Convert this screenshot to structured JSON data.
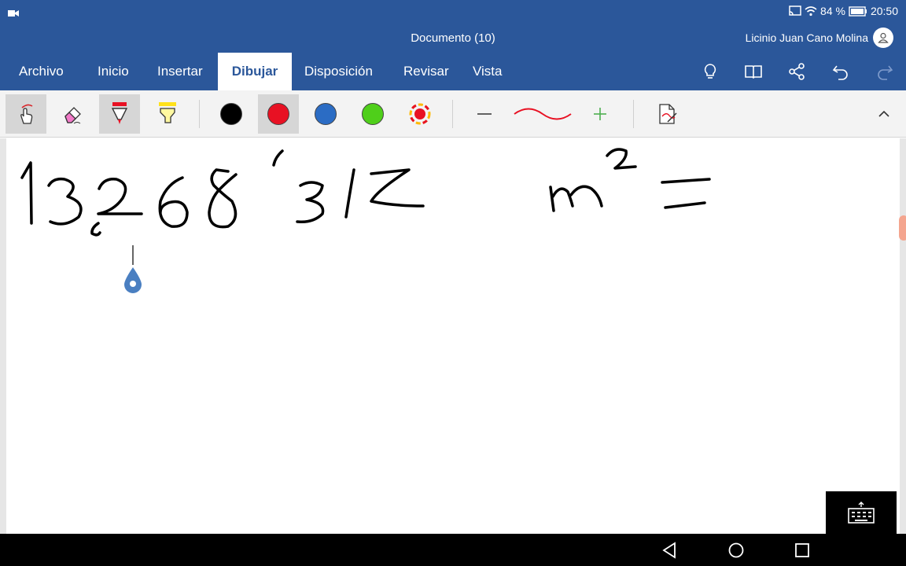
{
  "status_bar": {
    "battery_percent": "84 %",
    "time": "20:50",
    "icons": [
      "video-camera-icon",
      "cast-icon",
      "wifi-icon",
      "battery-icon"
    ]
  },
  "title_bar": {
    "document_title": "Documento (10)",
    "user_name": "Licinio Juan Cano Molina"
  },
  "tabs": [
    {
      "label": "Archivo",
      "active": false
    },
    {
      "label": "Inicio",
      "active": false
    },
    {
      "label": "Insertar",
      "active": false
    },
    {
      "label": "Dibujar",
      "active": true
    },
    {
      "label": "Disposición",
      "active": false
    },
    {
      "label": "Revisar",
      "active": false
    },
    {
      "label": "Vista",
      "active": false
    }
  ],
  "tab_actions": [
    "lightbulb-icon",
    "book-icon",
    "share-icon",
    "undo-icon",
    "redo-icon"
  ],
  "ribbon": {
    "tools": [
      "touch-draw-icon",
      "eraser-icon",
      "red-pen-icon",
      "yellow-highlighter-icon"
    ],
    "colors": [
      "#000000",
      "#e81123",
      "#2b6cc4",
      "#4fcf1a"
    ],
    "selected_color": "#e81123",
    "color_palette_icon": "color-wheel-icon",
    "stroke_options": [
      "thin-line-icon",
      "red-curve-icon",
      "add-pen-icon"
    ],
    "convert_icon": "ink-to-shape-icon",
    "collapse_icon": "chevron-up-icon"
  },
  "accent_color": "#2b579a",
  "navigation": [
    "back-icon",
    "home-icon",
    "recents-icon"
  ]
}
